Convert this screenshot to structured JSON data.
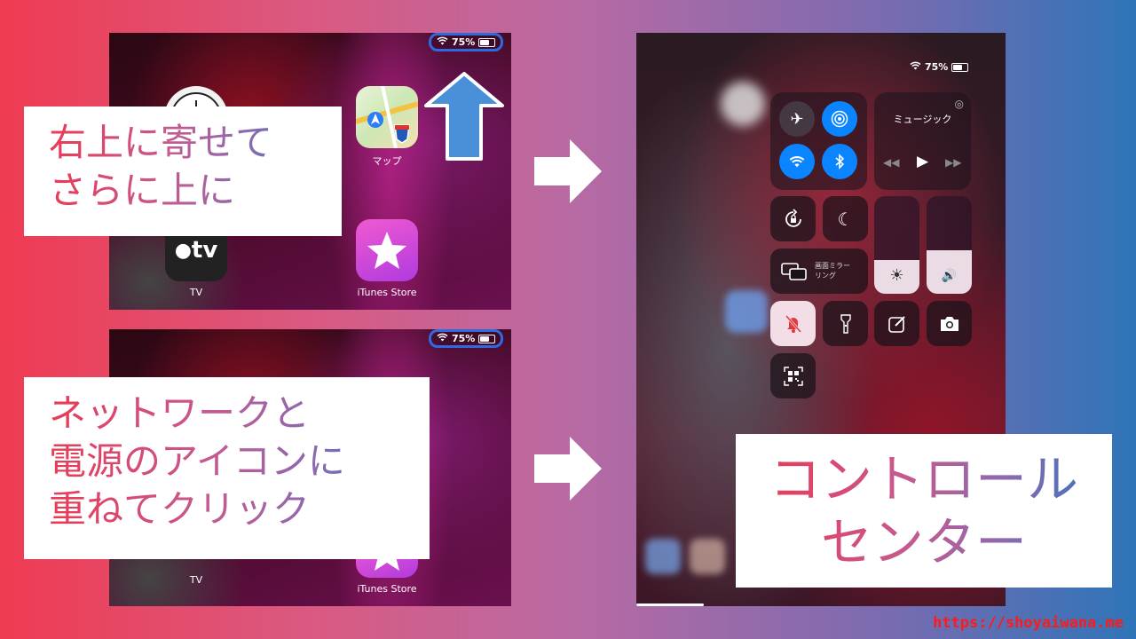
{
  "top_screen": {
    "battery": "75%",
    "apps": [
      {
        "name": "マップ",
        "icon": "maps-icon"
      },
      {
        "name": "TV",
        "icon": "appletv-icon"
      },
      {
        "name": "iTunes Store",
        "icon": "itunes-star-icon"
      }
    ]
  },
  "bottom_screen": {
    "battery": "75%",
    "apps": [
      {
        "name": "TV",
        "icon": "appletv-icon"
      },
      {
        "name": "iTunes Store",
        "icon": "itunes-star-icon"
      }
    ]
  },
  "tv_logo_text": "tv",
  "instruction_top": [
    "右上に寄せて",
    "さらに上に"
  ],
  "instruction_bottom": [
    "ネットワークと",
    "電源のアイコンに",
    "重ねてクリック"
  ],
  "control_center": {
    "battery": "75%",
    "music_label": "ミュージック",
    "mirroring_label_1": "画面ミラー",
    "mirroring_label_2": "リング",
    "brightness_level": 0.35,
    "volume_level": 0.45
  },
  "result_label": [
    "コントロール",
    "センター"
  ],
  "url": "https://shoyaiwana.me",
  "colors": {
    "accent_blue": "#2f6ae0",
    "cc_active_blue": "#0a84ff",
    "url_red": "#ff1a1a"
  }
}
